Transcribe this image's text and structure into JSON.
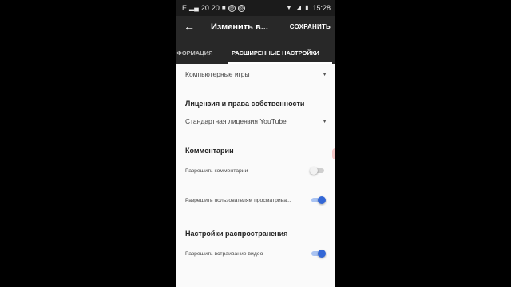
{
  "status_bar": {
    "carrier_text": "E",
    "signal_a": "20",
    "signal_b": "20",
    "time": "15:28"
  },
  "app_bar": {
    "title": "Изменить в...",
    "save_label": "СОХРАНИТЬ"
  },
  "tabs": [
    {
      "label": "НФОРМАЦИЯ"
    },
    {
      "label": "РАСШИРЕННЫЕ НАСТРОЙКИ"
    }
  ],
  "category_dropdown": {
    "value": "Компьютерные игры"
  },
  "license": {
    "heading": "Лицензия и права собственности",
    "value": "Стандартная лицензия YouTube"
  },
  "comments": {
    "heading": "Комментарии",
    "items": [
      {
        "label": "Разрешить комментарии",
        "enabled": false
      },
      {
        "label": "Разрешить пользователям просматрива...",
        "enabled": true
      }
    ]
  },
  "distribution": {
    "heading": "Настройки распространения",
    "items": [
      {
        "label": "Разрешить встраивание видео",
        "enabled": true
      }
    ]
  },
  "colors": {
    "app_bar": "#282828",
    "accent": "#3367d6"
  }
}
